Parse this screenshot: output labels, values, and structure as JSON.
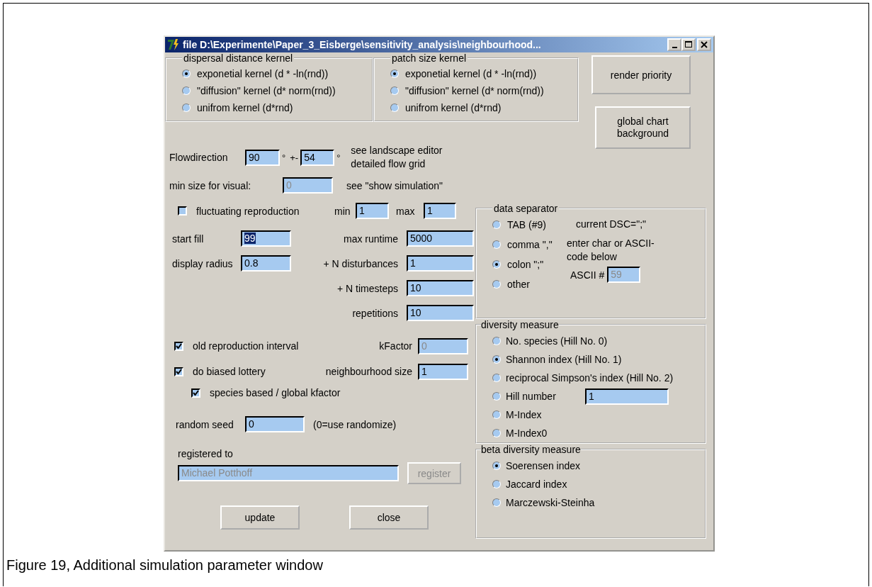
{
  "window": {
    "title": "file D:\\Experimente\\Paper_3_Eisberge\\sensitivity_analysis\\neighbourhood..."
  },
  "kernel_groups": [
    {
      "title": "dispersal distance kernel",
      "options": [
        {
          "label": "exponetial kernel (d * -ln(rnd))",
          "selected": true
        },
        {
          "label": "\"diffusion\" kernel (d* norm(rnd))",
          "selected": false
        },
        {
          "label": "unifrom kernel (d*rnd)",
          "selected": false
        }
      ]
    },
    {
      "title": "patch size kernel",
      "options": [
        {
          "label": "exponetial kernel (d * -ln(rnd))",
          "selected": true
        },
        {
          "label": "\"diffusion\" kernel (d* norm(rnd))",
          "selected": false
        },
        {
          "label": "unifrom kernel (d*rnd)",
          "selected": false
        }
      ]
    }
  ],
  "side_buttons": [
    "render priority",
    "global chart background"
  ],
  "flow": {
    "label": "Flowdirection",
    "value": "90",
    "unit": "°",
    "plus_minus": "+-",
    "spread": "54",
    "spread_unit": "°",
    "notes": [
      "see landscape editor",
      "detailed flow grid"
    ]
  },
  "min_size": {
    "label": "min size for visual:",
    "value": "0",
    "disabled": true,
    "note": "see \"show simulation\""
  },
  "fluctuating": {
    "label": "fluctuating reproduction",
    "checked": false,
    "min_label": "min",
    "min": "1",
    "max_label": "max",
    "max": "1"
  },
  "start_fill": {
    "label": "start fill",
    "value": "99",
    "highlighted": true
  },
  "display_radius": {
    "label": "display radius",
    "value": "0.8"
  },
  "run_fields": [
    {
      "label": "max runtime",
      "value": "5000"
    },
    {
      "label": "+ N disturbances",
      "value": "1"
    },
    {
      "label": "+ N timesteps",
      "value": "10"
    },
    {
      "label": "repetitions",
      "value": "10"
    }
  ],
  "options": [
    {
      "label": "old reproduction interval",
      "checked": true
    },
    {
      "label": "do biased lottery",
      "checked": true,
      "children": [
        {
          "label": "species based / global kfactor",
          "checked": true
        }
      ]
    }
  ],
  "kfactor": {
    "label": "kFactor",
    "value": "0",
    "disabled": true
  },
  "neighbourhood": {
    "label": "neighbourhood size",
    "value": "1",
    "disabled": false
  },
  "random_seed": {
    "label": "random seed",
    "value": "0",
    "note": "(0=use randomize)"
  },
  "registration": {
    "label": "registered to",
    "value": "Michael Potthoff",
    "disabled": true,
    "button": "register",
    "button_disabled": true
  },
  "buttons": [
    "update",
    "close"
  ],
  "data_separator": {
    "title": "data separator",
    "options": [
      {
        "label": "TAB (#9)",
        "selected": false
      },
      {
        "label": "comma \",\"",
        "selected": false
      },
      {
        "label": "colon \";\"",
        "selected": true
      },
      {
        "label": "other",
        "selected": false
      }
    ],
    "current": "current DSC=\";\"",
    "hint": "enter char or ASCII-code below",
    "ascii_label": "ASCII #",
    "ascii_value": "59",
    "ascii_disabled": true
  },
  "diversity": {
    "title": "diversity measure",
    "options": [
      {
        "label": "No. species (Hill No. 0)",
        "selected": false
      },
      {
        "label": "Shannon index (Hill No. 1)",
        "selected": true
      },
      {
        "label": "reciprocal Simpson's index (Hill No. 2)",
        "selected": false
      },
      {
        "label": "Hill number",
        "selected": false,
        "value": "1"
      },
      {
        "label": "M-Index",
        "selected": false
      },
      {
        "label": "M-Index0",
        "selected": false
      }
    ]
  },
  "beta_diversity": {
    "title": "beta diversity measure",
    "options": [
      {
        "label": "Soerensen index",
        "selected": true
      },
      {
        "label": "Jaccard index",
        "selected": false
      },
      {
        "label": "Marczewski-Steinha",
        "selected": false
      }
    ]
  },
  "caption": "Figure 19, Additional simulation parameter window"
}
